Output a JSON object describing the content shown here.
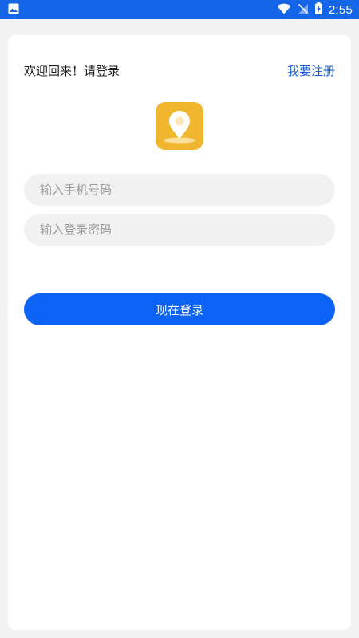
{
  "status_bar": {
    "time": "2:55",
    "icons": [
      "gallery-icon",
      "wifi-icon",
      "no-signal-icon",
      "battery-charging-icon"
    ]
  },
  "header": {
    "welcome_text": "欢迎回来！请登录",
    "register_label": "我要注册"
  },
  "logo": {
    "icon": "location-pin-icon",
    "background": "#f0b62e"
  },
  "form": {
    "phone": {
      "placeholder": "输入手机号码",
      "value": ""
    },
    "password": {
      "placeholder": "输入登录密码",
      "value": ""
    },
    "login_label": "现在登录"
  },
  "colors": {
    "status_bar": "#1565e8",
    "accent": "#0a63f5",
    "link": "#1a5fdc",
    "input_background": "#f1f1f1"
  }
}
